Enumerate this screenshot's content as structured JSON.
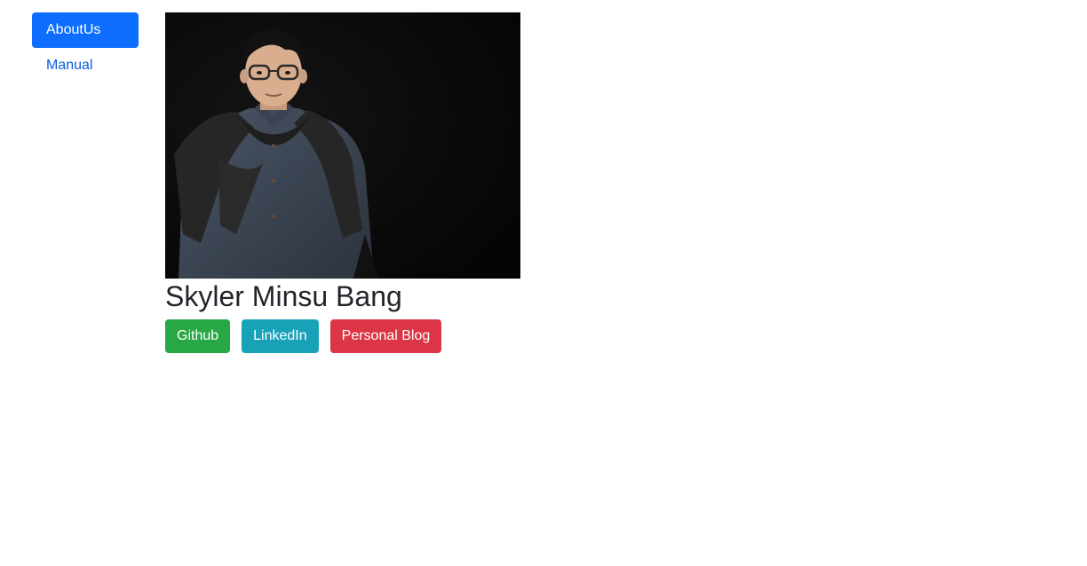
{
  "nav": {
    "items": [
      {
        "label": "AboutUs",
        "active": true
      },
      {
        "label": "Manual",
        "active": false
      }
    ]
  },
  "profile": {
    "name": "Skyler Minsu Bang",
    "photo_icon": "profile-photo"
  },
  "links": [
    {
      "label": "Github",
      "color": "#28a745"
    },
    {
      "label": "LinkedIn",
      "color": "#17a2b8"
    },
    {
      "label": "Personal Blog",
      "color": "#dc3545"
    }
  ],
  "colors": {
    "accent": "#0d6efd",
    "link_text": "#0b5ed7",
    "heading": "#212529"
  }
}
